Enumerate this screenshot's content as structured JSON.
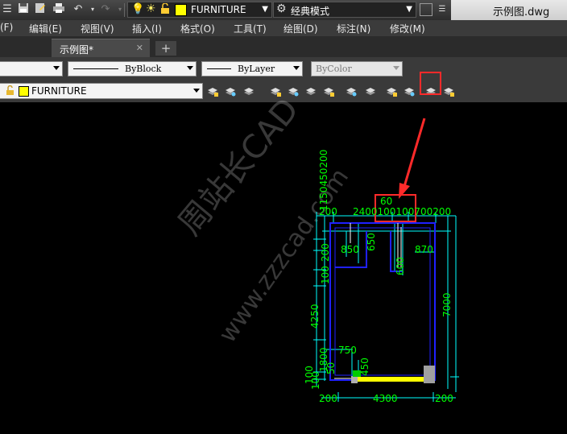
{
  "quick_access": {
    "layer_name": "FURNITURE",
    "workspace": "经典模式",
    "file_title": "示例图.dwg",
    "layer_color": "#ffff00"
  },
  "menu": {
    "items": [
      "(F)",
      "编辑(E)",
      "视图(V)",
      "插入(I)",
      "格式(O)",
      "工具(T)",
      "绘图(D)",
      "标注(N)",
      "修改(M)"
    ]
  },
  "tabs": {
    "active": "示例图*",
    "new_tab": "+",
    "close": "✕"
  },
  "properties": {
    "linetype": "ByBlock",
    "lineweight": "ByLayer",
    "plot_style": "ByColor"
  },
  "layers_toolbar": {
    "current_layer": "FURNITURE"
  },
  "drawing": {
    "dims": {
      "top_200_left": "200",
      "top_chain": "2400100100700200",
      "bottom_200_left": "200",
      "bottom_4300": "4300",
      "bottom_200_right": "200",
      "left_chain_top": "1150450200",
      "left_200": "200",
      "left_100": "100",
      "left_4250": "4250",
      "left_chain_bottom": "1800",
      "left_small_1": "100",
      "left_small_2": "100",
      "d850": "850",
      "d650": "650",
      "d60": "60",
      "d870": "870",
      "d600": "600",
      "right_7000": "7000",
      "d750": "750",
      "d450": "450",
      "d50": "50"
    },
    "watermark_cn": "周站长CAD",
    "watermark_url": "www.zzzcad.com"
  },
  "colors": {
    "accent": "#ff2a2a",
    "dim": "#00ff00",
    "dimline": "#00ffff",
    "wall": "#2020ff"
  }
}
